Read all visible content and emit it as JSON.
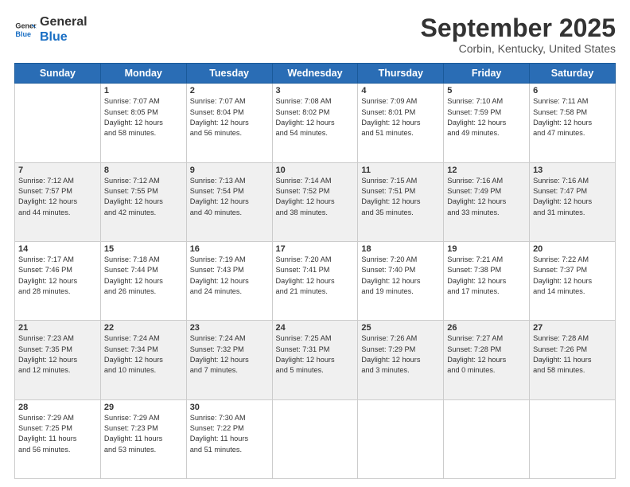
{
  "logo": {
    "general": "General",
    "blue": "Blue"
  },
  "header": {
    "month": "September 2025",
    "location": "Corbin, Kentucky, United States"
  },
  "days_of_week": [
    "Sunday",
    "Monday",
    "Tuesday",
    "Wednesday",
    "Thursday",
    "Friday",
    "Saturday"
  ],
  "weeks": [
    [
      {
        "day": "",
        "info": ""
      },
      {
        "day": "1",
        "info": "Sunrise: 7:07 AM\nSunset: 8:05 PM\nDaylight: 12 hours\nand 58 minutes."
      },
      {
        "day": "2",
        "info": "Sunrise: 7:07 AM\nSunset: 8:04 PM\nDaylight: 12 hours\nand 56 minutes."
      },
      {
        "day": "3",
        "info": "Sunrise: 7:08 AM\nSunset: 8:02 PM\nDaylight: 12 hours\nand 54 minutes."
      },
      {
        "day": "4",
        "info": "Sunrise: 7:09 AM\nSunset: 8:01 PM\nDaylight: 12 hours\nand 51 minutes."
      },
      {
        "day": "5",
        "info": "Sunrise: 7:10 AM\nSunset: 7:59 PM\nDaylight: 12 hours\nand 49 minutes."
      },
      {
        "day": "6",
        "info": "Sunrise: 7:11 AM\nSunset: 7:58 PM\nDaylight: 12 hours\nand 47 minutes."
      }
    ],
    [
      {
        "day": "7",
        "info": "Sunrise: 7:12 AM\nSunset: 7:57 PM\nDaylight: 12 hours\nand 44 minutes."
      },
      {
        "day": "8",
        "info": "Sunrise: 7:12 AM\nSunset: 7:55 PM\nDaylight: 12 hours\nand 42 minutes."
      },
      {
        "day": "9",
        "info": "Sunrise: 7:13 AM\nSunset: 7:54 PM\nDaylight: 12 hours\nand 40 minutes."
      },
      {
        "day": "10",
        "info": "Sunrise: 7:14 AM\nSunset: 7:52 PM\nDaylight: 12 hours\nand 38 minutes."
      },
      {
        "day": "11",
        "info": "Sunrise: 7:15 AM\nSunset: 7:51 PM\nDaylight: 12 hours\nand 35 minutes."
      },
      {
        "day": "12",
        "info": "Sunrise: 7:16 AM\nSunset: 7:49 PM\nDaylight: 12 hours\nand 33 minutes."
      },
      {
        "day": "13",
        "info": "Sunrise: 7:16 AM\nSunset: 7:47 PM\nDaylight: 12 hours\nand 31 minutes."
      }
    ],
    [
      {
        "day": "14",
        "info": "Sunrise: 7:17 AM\nSunset: 7:46 PM\nDaylight: 12 hours\nand 28 minutes."
      },
      {
        "day": "15",
        "info": "Sunrise: 7:18 AM\nSunset: 7:44 PM\nDaylight: 12 hours\nand 26 minutes."
      },
      {
        "day": "16",
        "info": "Sunrise: 7:19 AM\nSunset: 7:43 PM\nDaylight: 12 hours\nand 24 minutes."
      },
      {
        "day": "17",
        "info": "Sunrise: 7:20 AM\nSunset: 7:41 PM\nDaylight: 12 hours\nand 21 minutes."
      },
      {
        "day": "18",
        "info": "Sunrise: 7:20 AM\nSunset: 7:40 PM\nDaylight: 12 hours\nand 19 minutes."
      },
      {
        "day": "19",
        "info": "Sunrise: 7:21 AM\nSunset: 7:38 PM\nDaylight: 12 hours\nand 17 minutes."
      },
      {
        "day": "20",
        "info": "Sunrise: 7:22 AM\nSunset: 7:37 PM\nDaylight: 12 hours\nand 14 minutes."
      }
    ],
    [
      {
        "day": "21",
        "info": "Sunrise: 7:23 AM\nSunset: 7:35 PM\nDaylight: 12 hours\nand 12 minutes."
      },
      {
        "day": "22",
        "info": "Sunrise: 7:24 AM\nSunset: 7:34 PM\nDaylight: 12 hours\nand 10 minutes."
      },
      {
        "day": "23",
        "info": "Sunrise: 7:24 AM\nSunset: 7:32 PM\nDaylight: 12 hours\nand 7 minutes."
      },
      {
        "day": "24",
        "info": "Sunrise: 7:25 AM\nSunset: 7:31 PM\nDaylight: 12 hours\nand 5 minutes."
      },
      {
        "day": "25",
        "info": "Sunrise: 7:26 AM\nSunset: 7:29 PM\nDaylight: 12 hours\nand 3 minutes."
      },
      {
        "day": "26",
        "info": "Sunrise: 7:27 AM\nSunset: 7:28 PM\nDaylight: 12 hours\nand 0 minutes."
      },
      {
        "day": "27",
        "info": "Sunrise: 7:28 AM\nSunset: 7:26 PM\nDaylight: 11 hours\nand 58 minutes."
      }
    ],
    [
      {
        "day": "28",
        "info": "Sunrise: 7:29 AM\nSunset: 7:25 PM\nDaylight: 11 hours\nand 56 minutes."
      },
      {
        "day": "29",
        "info": "Sunrise: 7:29 AM\nSunset: 7:23 PM\nDaylight: 11 hours\nand 53 minutes."
      },
      {
        "day": "30",
        "info": "Sunrise: 7:30 AM\nSunset: 7:22 PM\nDaylight: 11 hours\nand 51 minutes."
      },
      {
        "day": "",
        "info": ""
      },
      {
        "day": "",
        "info": ""
      },
      {
        "day": "",
        "info": ""
      },
      {
        "day": "",
        "info": ""
      }
    ]
  ]
}
